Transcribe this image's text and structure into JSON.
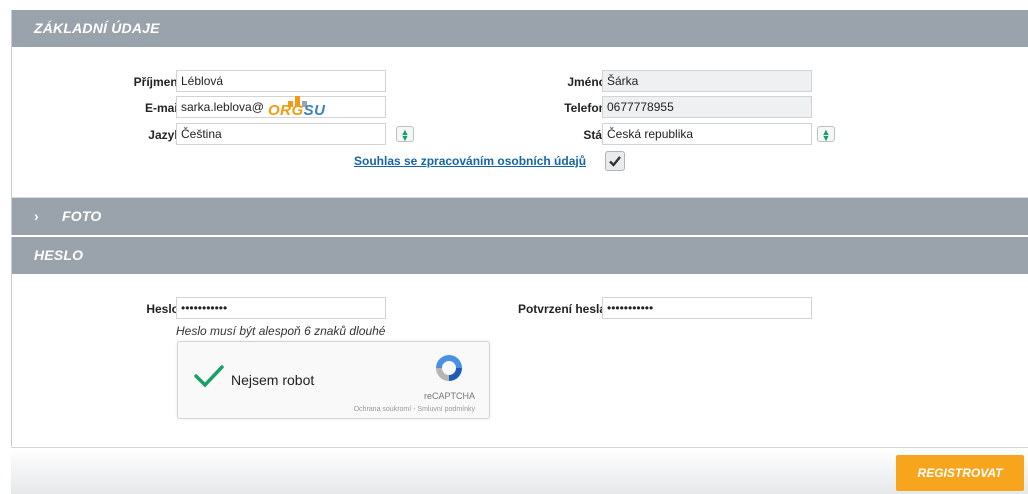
{
  "sections": {
    "basic": {
      "title": "ZÁKLADNÍ ÚDAJE"
    },
    "photo": {
      "title": "FOTO"
    },
    "password": {
      "title": "HESLO"
    }
  },
  "basic": {
    "surname": {
      "label": "Příjmení",
      "value": "Léblová"
    },
    "email": {
      "label": "E-mail",
      "value": "sarka.leblova@"
    },
    "language": {
      "label": "Jazyk",
      "value": "Čeština"
    },
    "firstname": {
      "label": "Jméno",
      "value": "Šárka"
    },
    "phone": {
      "label": "Telefon",
      "value": "0677778955"
    },
    "country": {
      "label": "Stát",
      "value": "Česká republika"
    },
    "consent": {
      "label": "Souhlas se zpracováním osobních údajů",
      "checked": true
    }
  },
  "password": {
    "password": {
      "label": "Heslo",
      "value": "•••••••••••"
    },
    "confirm": {
      "label": "Potvrzení hesla",
      "value": "•••••••••••"
    },
    "hint": "Heslo musí být alespoň 6 znaků dlouhé"
  },
  "captcha": {
    "label": "Nejsem robot",
    "brand": "reCAPTCHA",
    "terms": "Ochrana soukromí - Smluvní podmínky",
    "checked": true
  },
  "watermark": {
    "text_a": "ORG",
    "text_b": "SU"
  },
  "actions": {
    "submit": "REGISTROVAT"
  },
  "colors": {
    "header": "#9aa3ab",
    "accent": "#f7a51d",
    "link": "#1565a8",
    "check": "#19a06a"
  }
}
